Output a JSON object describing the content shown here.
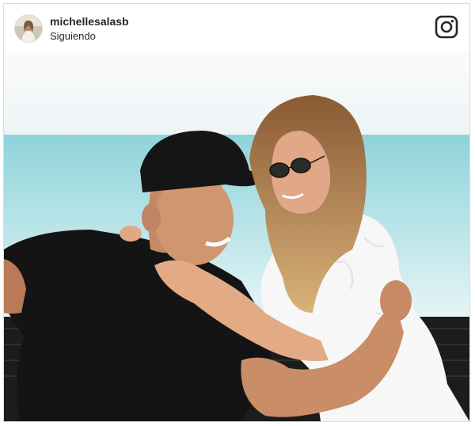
{
  "post": {
    "username": "michellesalasb",
    "follow_status": "Siguiendo"
  },
  "icons": {
    "platform": "instagram-icon"
  },
  "photo": {
    "subject": "couple-on-beach-photo"
  }
}
